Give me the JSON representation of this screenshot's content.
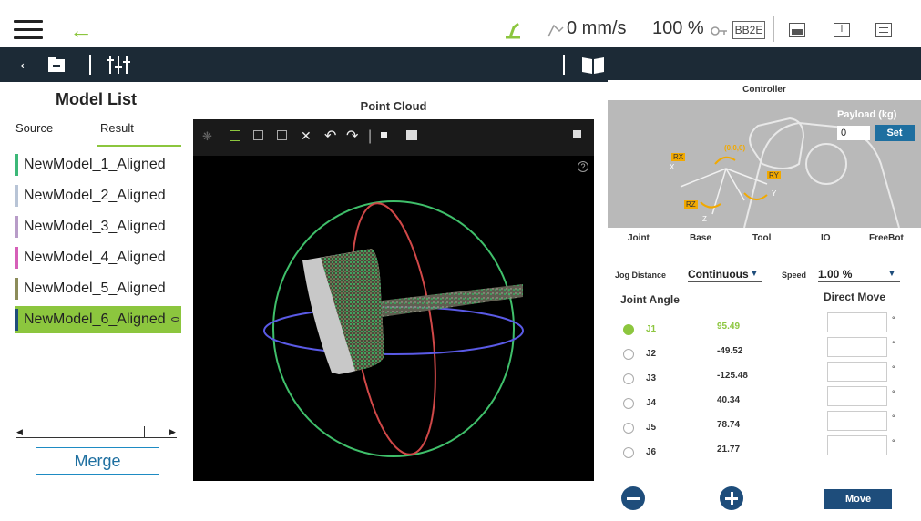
{
  "status_bar": {
    "speed": "0 mm/s",
    "percent": "100 %",
    "robot_id": "BB2E"
  },
  "model_list": {
    "title": "Model List",
    "tabs": {
      "source": "Source",
      "result": "Result"
    },
    "items": [
      {
        "label": "NewModel_1_Aligned",
        "color": "#3cb878"
      },
      {
        "label": "NewModel_2_Aligned",
        "color": "#b8c4d6"
      },
      {
        "label": "NewModel_3_Aligned",
        "color": "#b89cc8"
      },
      {
        "label": "NewModel_4_Aligned",
        "color": "#d65fb8"
      },
      {
        "label": "NewModel_5_Aligned",
        "color": "#8c8c5a"
      },
      {
        "label": "NewModel_6_Aligned",
        "color": "#1e4d7b"
      }
    ],
    "selected_index": 5,
    "selected_color": "#8cc63e",
    "merge_label": "Merge"
  },
  "point_cloud": {
    "title": "Point Cloud"
  },
  "controller": {
    "title": "Controller",
    "payload_label": "Payload (kg)",
    "payload_value": "0",
    "set_label": "Set",
    "axis_labels": {
      "rx": "RX",
      "ry": "RY",
      "rz": "RZ",
      "x": "X",
      "y": "Y",
      "z": "Z",
      "origin": "(0,0,0)"
    },
    "tabs": [
      "Joint",
      "Base",
      "Tool",
      "IO",
      "FreeBot"
    ],
    "jog_distance_label": "Jog Distance",
    "jog_distance_value": "Continuous",
    "speed_label": "Speed",
    "speed_value": "1.00 %",
    "joint_angle_label": "Joint Angle",
    "direct_move_label": "Direct Move",
    "joints": [
      {
        "name": "J1",
        "value": "95.49",
        "active": true
      },
      {
        "name": "J2",
        "value": "-49.52",
        "active": false
      },
      {
        "name": "J3",
        "value": "-125.48",
        "active": false
      },
      {
        "name": "J4",
        "value": "40.34",
        "active": false
      },
      {
        "name": "J5",
        "value": "78.74",
        "active": false
      },
      {
        "name": "J6",
        "value": "21.77",
        "active": false
      }
    ],
    "degree_symbol": "°",
    "move_label": "Move",
    "accent": "#8cc63e",
    "button_color": "#1e4d7b"
  }
}
